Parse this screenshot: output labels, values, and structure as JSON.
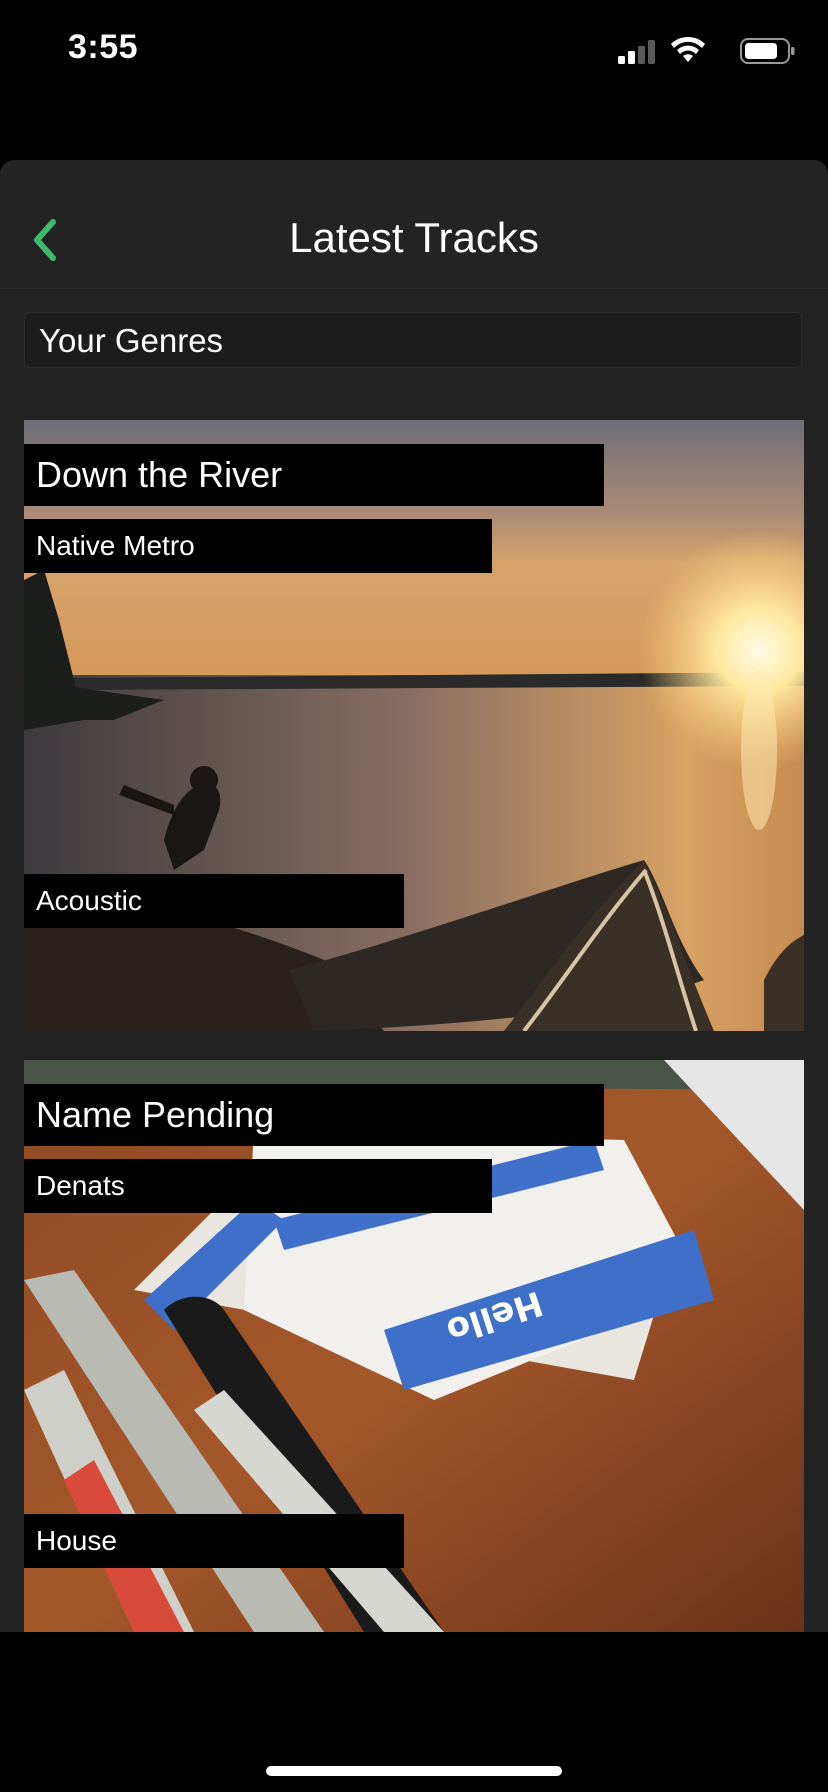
{
  "status": {
    "time": "3:55"
  },
  "nav": {
    "title": "Latest Tracks",
    "back_icon": "chevron-left-icon",
    "accent": "#3dbb6c"
  },
  "genres": {
    "value": "Your Genres"
  },
  "tracks": [
    {
      "title": "Down the River",
      "artist": "Native Metro",
      "genre": "Acoustic",
      "art": "lake-sunset-canoe"
    },
    {
      "title": "Name Pending",
      "artist": "Denats",
      "genre": "House",
      "art": "name-tags-markers"
    }
  ]
}
